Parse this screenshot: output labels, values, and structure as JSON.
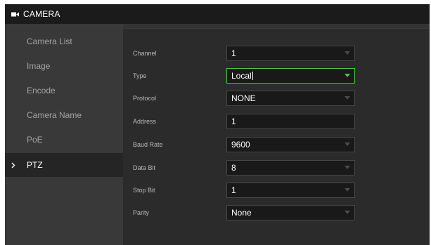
{
  "header": {
    "title": "CAMERA",
    "icon": "video-camera-icon"
  },
  "sidebar": {
    "items": [
      {
        "label": "Camera List",
        "active": false
      },
      {
        "label": "Image",
        "active": false
      },
      {
        "label": "Encode",
        "active": false
      },
      {
        "label": "Camera Name",
        "active": false
      },
      {
        "label": "PoE",
        "active": false
      },
      {
        "label": "PTZ",
        "active": true
      }
    ],
    "active_indicator": ">"
  },
  "form": {
    "fields": [
      {
        "label": "Channel",
        "value": "1",
        "type": "select"
      },
      {
        "label": "Type",
        "value": "Local",
        "type": "select",
        "focused": true
      },
      {
        "label": "Protocol",
        "value": "NONE",
        "type": "select"
      },
      {
        "label": "Address",
        "value": "1",
        "type": "input"
      },
      {
        "label": "Baud Rate",
        "value": "9600",
        "type": "select"
      },
      {
        "label": "Data Bit",
        "value": "8",
        "type": "select"
      },
      {
        "label": "Stop Bit",
        "value": "1",
        "type": "select"
      },
      {
        "label": "Parity",
        "value": "None",
        "type": "select"
      }
    ]
  },
  "colors": {
    "accent": "#4cc640",
    "background": "#2b2b2b",
    "sidebar": "#393939",
    "header": "#1b1b1b"
  }
}
